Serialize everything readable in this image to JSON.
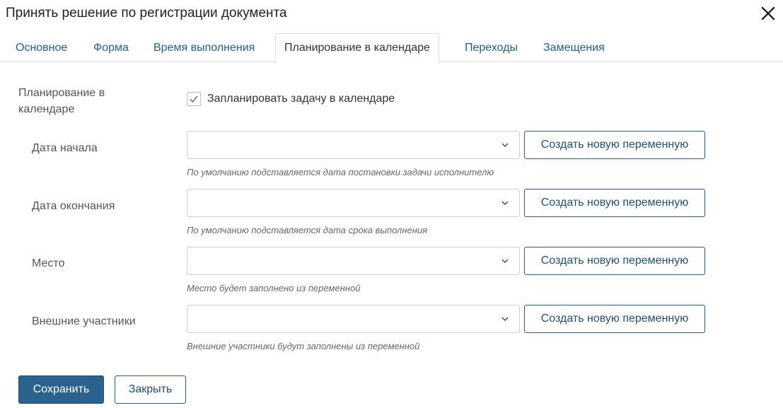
{
  "dialog": {
    "title": "Принять решение по регистрации документа"
  },
  "tabs": [
    {
      "label": "Основное"
    },
    {
      "label": "Форма"
    },
    {
      "label": "Время выполнения"
    },
    {
      "label": "Планирование в календаре",
      "active": true
    },
    {
      "label": "Переходы"
    },
    {
      "label": "Замещения"
    }
  ],
  "calendar": {
    "section_label": "Планирование в календаре",
    "checkbox_label": "Запланировать задачу в календаре",
    "checkbox_checked": true
  },
  "fields": [
    {
      "label": "Дата начала",
      "value": "",
      "button_label": "Создать новую переменную",
      "hint": "По умолчанию подставляется дата постановки задачи исполнителю"
    },
    {
      "label": "Дата окончания",
      "value": "",
      "button_label": "Создать новую переменную",
      "hint": "По умолчанию подставляется дата срока выполнения"
    },
    {
      "label": "Место",
      "value": "",
      "button_label": "Создать новую переменную",
      "hint": "Место будет заполнено из переменной"
    },
    {
      "label": "Внешние участники",
      "value": "",
      "button_label": "Создать новую переменную",
      "hint": "Внешние участники будут заполнены из переменной"
    }
  ],
  "footer": {
    "save_label": "Сохранить",
    "close_label": "Закрыть"
  },
  "icons": {
    "close": "close-icon",
    "chevron": "chevron-down-icon",
    "check": "check-icon"
  },
  "colors": {
    "accent": "#2b6390",
    "link": "#1f5f8f"
  }
}
